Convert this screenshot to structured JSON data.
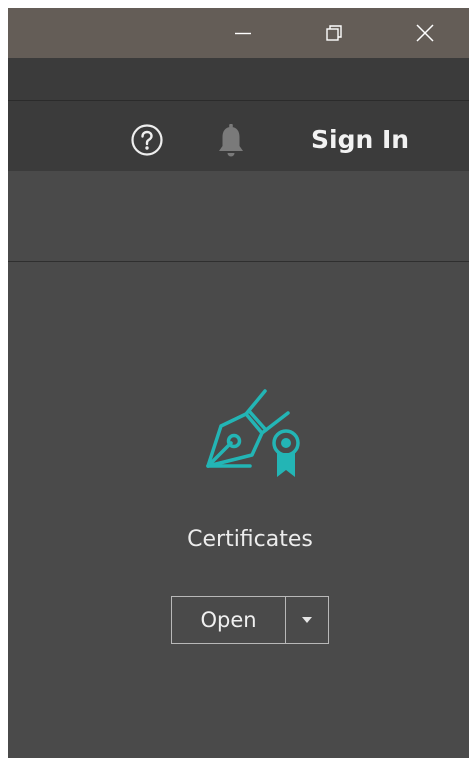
{
  "window_controls": {
    "minimize_icon": "minimize-icon",
    "restore_icon": "restore-icon",
    "close_icon": "close-icon"
  },
  "toolbar": {
    "help_icon": "help-icon",
    "notifications_icon": "bell-icon",
    "sign_in_label": "Sign In"
  },
  "tool": {
    "icon": "pen-certificate-icon",
    "title": "Certificates",
    "open_label": "Open",
    "dropdown_icon": "chevron-down-icon"
  },
  "colors": {
    "accent": "#23b5b5",
    "titlebar": "#645d57",
    "panel": "#4a4a4a",
    "toolbar": "#3b3b3b"
  }
}
